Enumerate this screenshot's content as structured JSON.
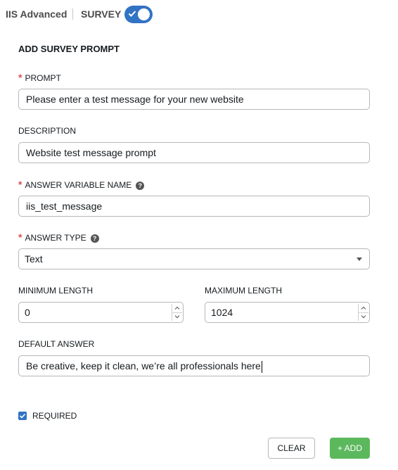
{
  "header": {
    "title": "IIS Advanced",
    "survey_label": "SURVEY",
    "survey_toggle_on": true
  },
  "form": {
    "section_title": "ADD SURVEY PROMPT",
    "prompt": {
      "label": "PROMPT",
      "required": true,
      "value": "Please enter a test message for your new website"
    },
    "description": {
      "label": "DESCRIPTION",
      "value": "Website test message prompt"
    },
    "answer_variable_name": {
      "label": "ANSWER VARIABLE NAME",
      "required": true,
      "value": "iis_test_message"
    },
    "answer_type": {
      "label": "ANSWER TYPE",
      "required": true,
      "value": "Text"
    },
    "minimum_length": {
      "label": "MINIMUM LENGTH",
      "value": "0"
    },
    "maximum_length": {
      "label": "MAXIMUM LENGTH",
      "value": "1024"
    },
    "default_answer": {
      "label": "DEFAULT ANSWER",
      "value": "Be creative, keep it clean, we’re all professionals here"
    },
    "required_checkbox": {
      "label": "REQUIRED",
      "checked": true
    }
  },
  "actions": {
    "clear_label": "CLEAR",
    "add_label": "+ ADD"
  },
  "colors": {
    "accent": "#3273c4",
    "add_button": "#5cb85c",
    "required_star": "#d9534f"
  },
  "icons": {
    "help": "question-circle-icon",
    "toggle_check": "check-icon",
    "select_arrow": "caret-down-icon"
  }
}
